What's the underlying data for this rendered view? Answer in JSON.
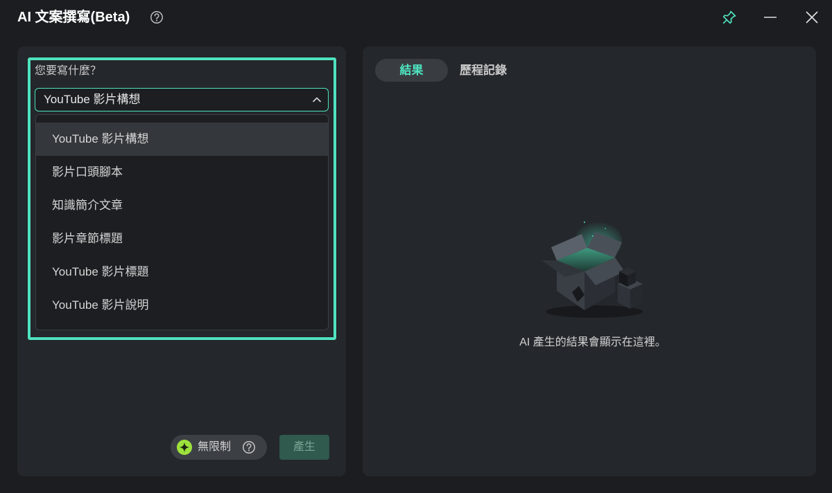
{
  "window": {
    "title": "AI 文案撰寫(Beta)",
    "icons": {
      "help": "help-circle-icon",
      "pin": "pin-icon",
      "minimize": "minimize-icon",
      "close": "close-icon"
    }
  },
  "form": {
    "prompt_label": "您要寫什麼？",
    "select": {
      "value": "YouTube 影片構想",
      "expanded": true,
      "icon": "chevron-up-icon"
    },
    "options": [
      {
        "label": "YouTube 影片構想",
        "highlighted": true
      },
      {
        "label": "影片口頭腳本",
        "highlighted": false
      },
      {
        "label": "知識簡介文章",
        "highlighted": false
      },
      {
        "label": "影片章節標題",
        "highlighted": false
      },
      {
        "label": "YouTube 影片標題",
        "highlighted": false
      },
      {
        "label": "YouTube 影片說明",
        "highlighted": false
      }
    ],
    "quota": {
      "label": "無限制",
      "icon": "sparkle-credit-icon",
      "help_icon": "help-circle-icon"
    },
    "generate_label": "產生",
    "generate_enabled": false
  },
  "results": {
    "tabs": [
      {
        "label": "結果",
        "active": true
      },
      {
        "label": "歷程記錄",
        "active": false
      }
    ],
    "illustration": "open-box-icon",
    "empty_message": "AI 產生的結果會顯示在這裡。"
  },
  "colors": {
    "accent": "#4fe3bf",
    "background": "#1b1d20",
    "panel": "#24272b",
    "field": "#1c1e21",
    "quota_badge": "#9de23c",
    "generate_disabled": "#2f5a4d"
  }
}
